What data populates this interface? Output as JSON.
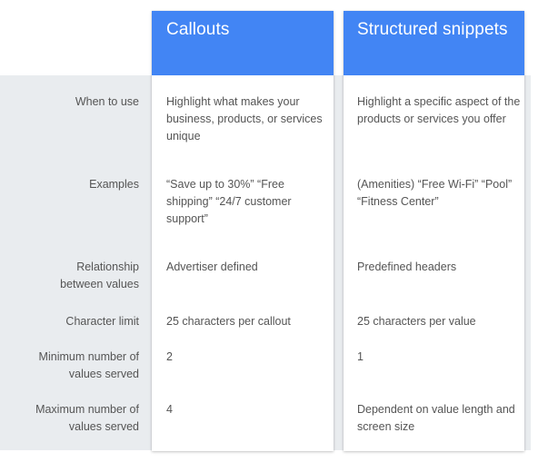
{
  "columns": [
    {
      "id": "callouts",
      "title": "Callouts"
    },
    {
      "id": "snippets",
      "title": "Structured snippets"
    }
  ],
  "header_colors": {
    "header_bg": "#4285f4",
    "band_bg": "#e9ecef"
  },
  "rows": [
    {
      "label": "When to use",
      "callouts": "Highlight what makes your business, products, or services unique",
      "snippets": "Highlight a specific aspect of the products or services you offer"
    },
    {
      "label": "Examples",
      "callouts": "“Save up to 30%” “Free shipping” “24/7 customer support”",
      "snippets": "(Amenities) “Free Wi-Fi” “Pool” “Fitness Center”"
    },
    {
      "label": "Relationship between values",
      "callouts": "Advertiser defined",
      "snippets": "Predefined headers"
    },
    {
      "label": "Character limit",
      "callouts": "25 characters per callout",
      "snippets": "25 characters per value"
    },
    {
      "label": "Minimum number of values served",
      "callouts": "2",
      "snippets": "1"
    },
    {
      "label": "Maximum number of values served",
      "callouts": "4",
      "snippets": "Dependent on value length and screen size"
    }
  ]
}
